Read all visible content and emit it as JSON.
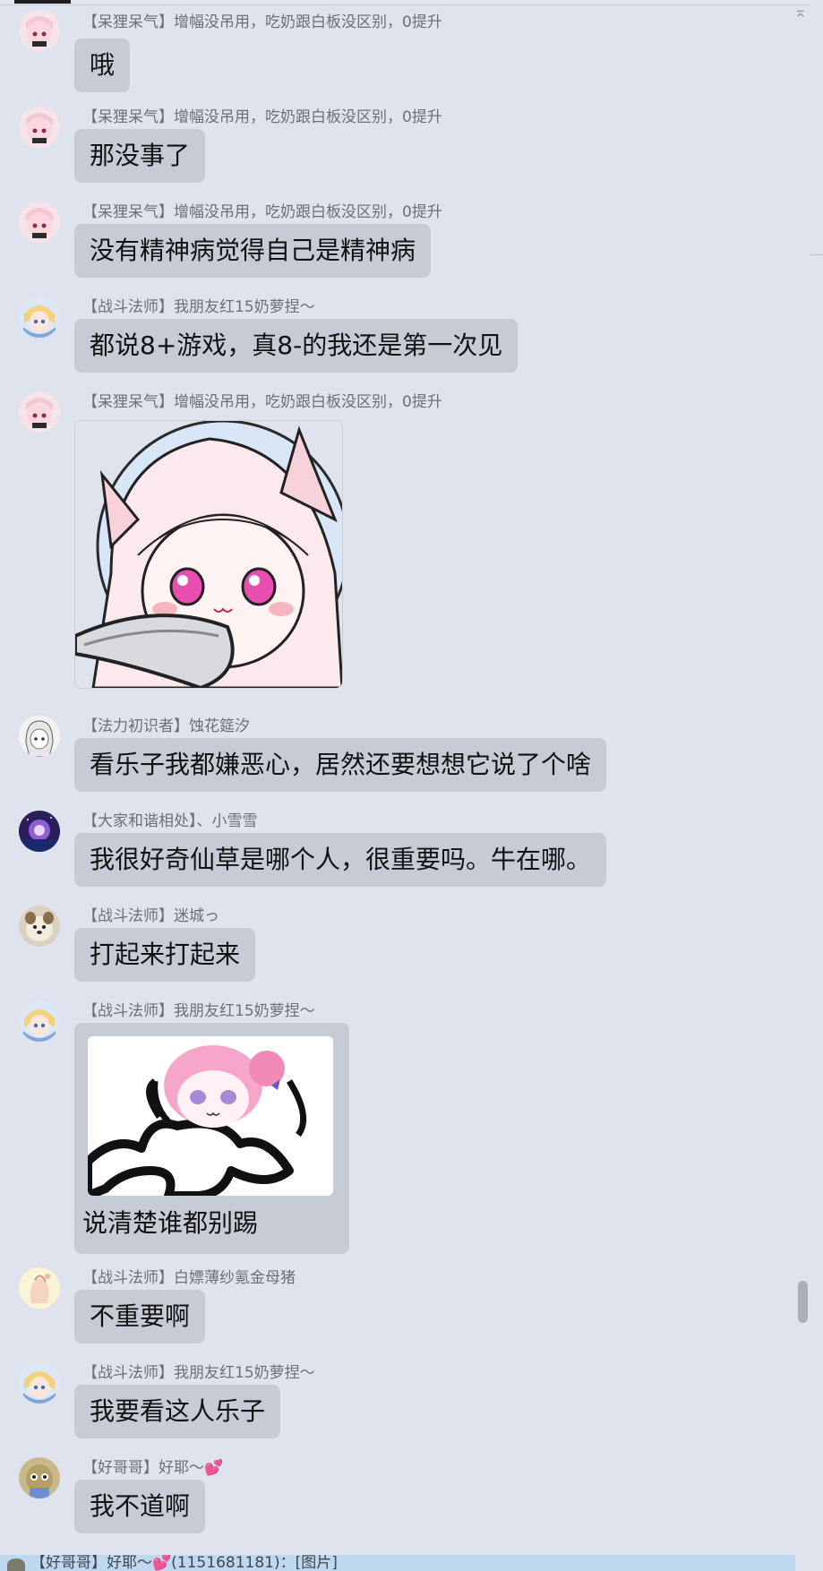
{
  "messages": [
    {
      "sender": "【呆狸呆气】增幅没吊用，吃奶跟白板没区别，0提升",
      "text": "哦"
    },
    {
      "sender": "【呆狸呆气】增幅没吊用，吃奶跟白板没区别，0提升",
      "text": "那没事了"
    },
    {
      "sender": "【呆狸呆气】增幅没吊用，吃奶跟白板没区别，0提升",
      "text": "没有精神病觉得自己是精神病"
    },
    {
      "sender": "【战斗法师】我朋友红15奶萝捏～",
      "text": "都说8+游戏，真8-的我还是第一次见"
    },
    {
      "sender": "【呆狸呆气】增幅没吊用，吃奶跟白板没区别，0提升",
      "image": "cat-girl-sticker"
    },
    {
      "sender": "【法力初识者】蚀花筵汐",
      "text": "看乐子我都嫌恶心，居然还要想想它说了个啥"
    },
    {
      "sender": "【大家和谐相处】、小雪雪",
      "text": "我很好奇仙草是哪个人，很重要吗。牛在哪。"
    },
    {
      "sender": "【战斗法师】迷城っ",
      "text": "打起来打起来"
    },
    {
      "sender": "【战斗法师】我朋友红15奶萝捏～",
      "image": "pink-hair-sticker",
      "caption": "说清楚谁都别踢"
    },
    {
      "sender": "【战斗法师】白嫖薄纱氪金母猪",
      "text": "不重要啊"
    },
    {
      "sender": "【战斗法师】我朋友红15奶萝捏～",
      "text": "我要看这人乐子"
    },
    {
      "sender": "【好哥哥】好耶～💕",
      "text": "我不道啊"
    }
  ],
  "quote_bar": {
    "text": "【好哥哥】好耶～💕(1151681181)：[图片]"
  },
  "icons": {
    "collapse": "chevron-up-icon"
  },
  "colors": {
    "background": "#dfe3ee",
    "bubble": "#c6cbd5",
    "sender_text": "#6b6f7a",
    "highlight": "#bed8f0"
  }
}
